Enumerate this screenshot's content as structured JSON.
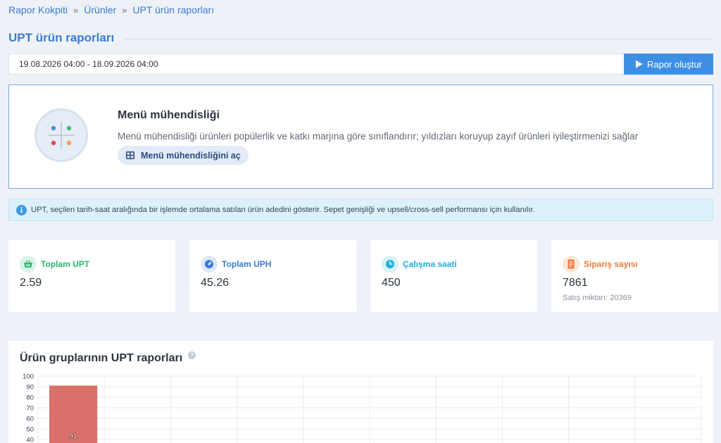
{
  "breadcrumb": {
    "items": [
      "Rapor Kokpiti",
      "Ürünler",
      "UPT ürün raporları"
    ],
    "separator": "»"
  },
  "page": {
    "title": "UPT ürün raporları"
  },
  "date_range": {
    "value": "19.08.2026 04:00 - 18.09.2026 04:00"
  },
  "actions": {
    "create_report": "Rapor oluştur"
  },
  "menu_engineering": {
    "title": "Menü mühendisliği",
    "description": "Menü mühendisliği ürünleri popülerlik ve katkı marjına göre sınıflandırır; yıldızları koruyup zayıf ürünleri iyileştirmenizi sağlar",
    "button_label": "Menü mühendisliğini aç"
  },
  "info": {
    "text": "UPT, seçilen tarih-saat aralığında bir işlemde ortalama satılan ürün adedini gösterir. Sepet genişliği ve upsell/cross-sell performansı için kullanılır."
  },
  "stats": [
    {
      "label": "Toplam UPT",
      "value": "2.59",
      "icon": "basket-icon",
      "color": "#2bb673"
    },
    {
      "label": "Toplam UPH",
      "value": "45.26",
      "icon": "gauge-icon",
      "color": "#3a7bd5"
    },
    {
      "label": "Çalışma saati",
      "value": "450",
      "icon": "clock-icon",
      "color": "#1fb0e0"
    },
    {
      "label": "Sipariş sayısı",
      "value": "7861",
      "sub": "Satış miktarı: 20369",
      "icon": "receipt-icon",
      "color": "#f07a3c"
    }
  ],
  "chart": {
    "title": "Ürün gruplarının UPT raporları"
  },
  "chart_data": {
    "type": "bar",
    "title": "Ürün gruplarının UPT raporları",
    "y_ticks": [
      100,
      90,
      80,
      70,
      60,
      50,
      40
    ],
    "categories": [
      ""
    ],
    "values": [
      91
    ],
    "data_labels": [
      "91"
    ],
    "ylim": [
      0,
      100
    ],
    "grid": true,
    "bar_color": "#d9706a"
  }
}
